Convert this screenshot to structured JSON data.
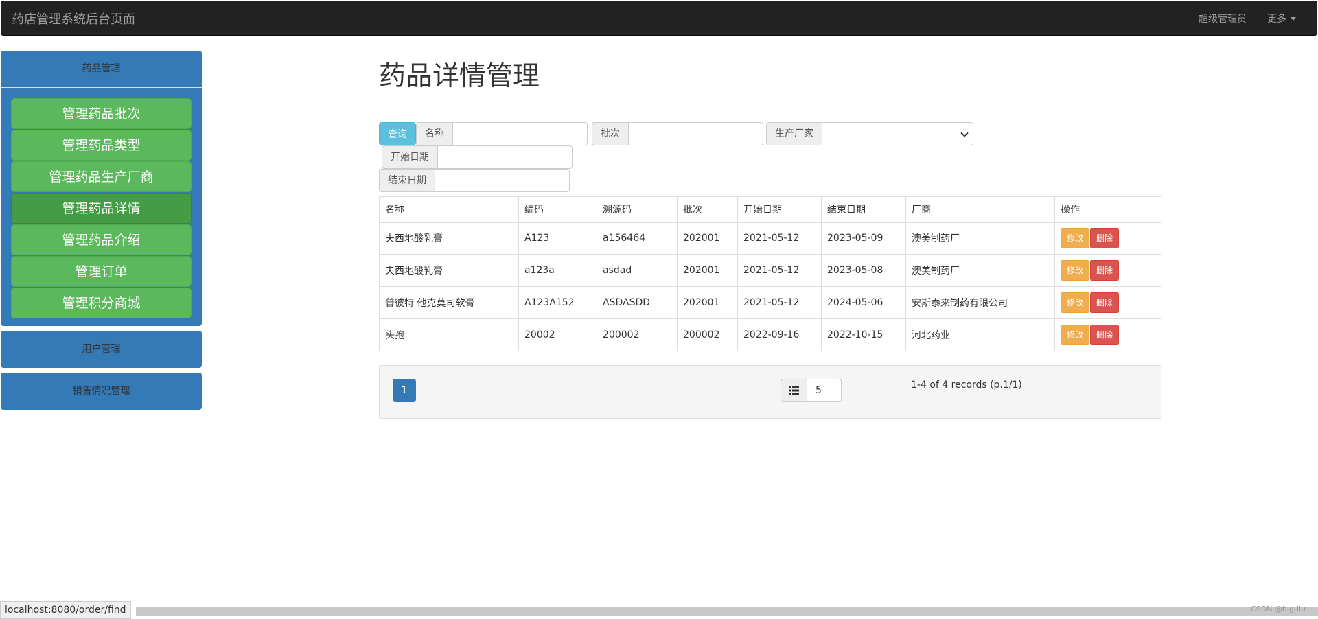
{
  "navbar": {
    "brand": "药店管理系统后台页面",
    "user": "超级管理员",
    "more": "更多"
  },
  "sidebar": {
    "drug_panel": {
      "title": "药品管理",
      "items": [
        {
          "label": "管理药品批次",
          "active": false
        },
        {
          "label": "管理药品类型",
          "active": false
        },
        {
          "label": "管理药品生产厂商",
          "active": false
        },
        {
          "label": "管理药品详情",
          "active": true
        },
        {
          "label": "管理药品介绍",
          "active": false
        },
        {
          "label": "管理订单",
          "active": false
        },
        {
          "label": "管理积分商城",
          "active": false
        }
      ]
    },
    "user_panel": {
      "title": "用户管理"
    },
    "sales_panel": {
      "title": "销售情况管理"
    }
  },
  "main": {
    "title": "药品详情管理",
    "search": {
      "query_button": "查询",
      "name_label": "名称",
      "batch_label": "批次",
      "maker_label": "生产厂家",
      "start_label": "开始日期",
      "end_label": "结束日期"
    },
    "table": {
      "headers": [
        "名称",
        "编码",
        "溯源码",
        "批次",
        "开始日期",
        "结束日期",
        "厂商",
        "操作"
      ],
      "rows": [
        [
          "夫西地酸乳膏",
          "A123",
          "a156464",
          "202001",
          "2021-05-12",
          "2023-05-09",
          "澳美制药厂"
        ],
        [
          "夫西地酸乳膏",
          "a123a",
          "asdad",
          "202001",
          "2021-05-12",
          "2023-05-08",
          "澳美制药厂"
        ],
        [
          "普彼特 他克莫司软膏",
          "A123A152",
          "ASDASDD",
          "202001",
          "2021-05-12",
          "2024-05-06",
          "安斯泰来制药有限公司"
        ],
        [
          "头孢",
          "20002",
          "200002",
          "200002",
          "2022-09-16",
          "2022-10-15",
          "河北药业"
        ]
      ],
      "edit_label": "修改",
      "delete_label": "删除"
    },
    "pager": {
      "current_page": "1",
      "page_size": "5",
      "records": "1-4 of 4 records (p.1/1)"
    }
  },
  "statusbar": {
    "url": "localhost:8080/order/find",
    "watermark": "CSDN @big-liu"
  }
}
